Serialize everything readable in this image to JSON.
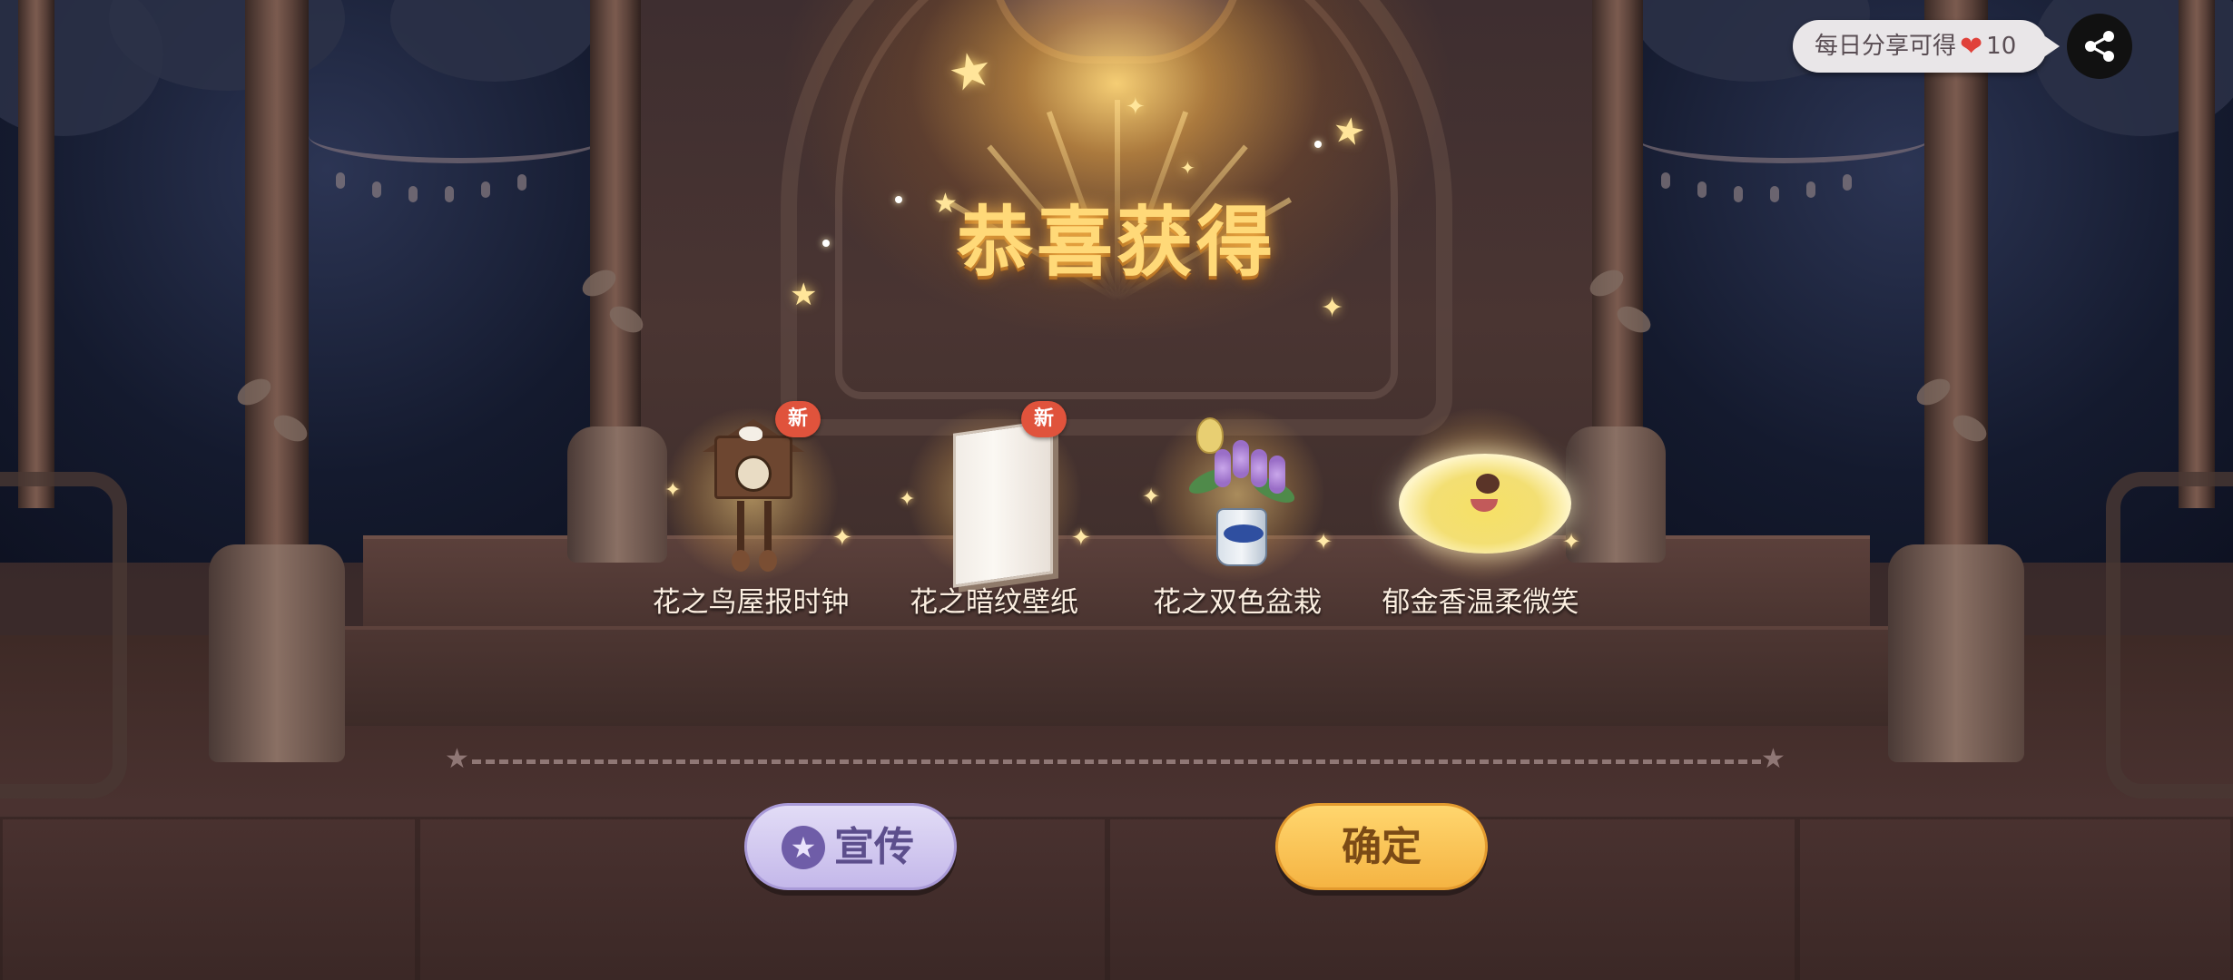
{
  "title": "恭喜获得",
  "share": {
    "label": "每日分享可得",
    "icon": "heart-icon",
    "amount": "10",
    "button_icon": "share-icon"
  },
  "items": [
    {
      "name": "花之鸟屋报时钟",
      "badge": "新",
      "icon": "cuckoo-clock-icon"
    },
    {
      "name": "花之暗纹壁纸",
      "badge": "新",
      "icon": "wallpaper-icon"
    },
    {
      "name": "花之双色盆栽",
      "badge": "",
      "icon": "potted-plant-icon"
    },
    {
      "name": "郁金香温柔微笑",
      "badge": "",
      "icon": "smile-face-icon"
    }
  ],
  "buttons": {
    "promote": "宣传",
    "promote_icon": "star-icon",
    "confirm": "确定"
  },
  "colors": {
    "title": "#ffd978",
    "badge": "#e0533c",
    "promote_button": "#c4b8ea",
    "confirm_button": "#f5b443"
  }
}
